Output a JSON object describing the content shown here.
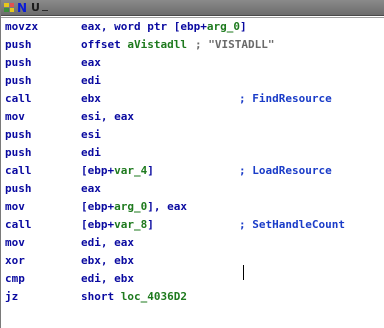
{
  "toolbar": {
    "n_letter": "N",
    "u_letter": "U"
  },
  "lines": [
    {
      "mnemonic": "movzx",
      "operand": "eax, word ptr [ebp+arg_0]"
    },
    {
      "mnemonic": "push",
      "operand": "offset aVistadll",
      "comment": "; \"VISTADLL\""
    },
    {
      "mnemonic": "push",
      "operand": "eax"
    },
    {
      "mnemonic": "push",
      "operand": "edi"
    },
    {
      "mnemonic": "call",
      "operand": "ebx",
      "comment": "; FindResource"
    },
    {
      "mnemonic": "mov",
      "operand": "esi, eax"
    },
    {
      "mnemonic": "push",
      "operand": "esi"
    },
    {
      "mnemonic": "push",
      "operand": "edi"
    },
    {
      "mnemonic": "call",
      "operand": "[ebp+var_4]",
      "comment": "; LoadResource"
    },
    {
      "mnemonic": "push",
      "operand": "eax"
    },
    {
      "mnemonic": "mov",
      "operand": "[ebp+arg_0], eax"
    },
    {
      "mnemonic": "call",
      "operand": "[ebp+var_8]",
      "comment": "; SetHandleCount"
    },
    {
      "mnemonic": "mov",
      "operand": "edi, eax"
    },
    {
      "mnemonic": "xor",
      "operand": "ebx, ebx"
    },
    {
      "mnemonic": "cmp",
      "operand": "edi, ebx"
    },
    {
      "mnemonic": "jz",
      "operand": "short loc_4036D2"
    }
  ],
  "colors": {
    "mnemonic": "#0a0aa0",
    "symbol": "#1e7a1e",
    "comment": "#1a3cc8",
    "string_comment": "#6a6a6a"
  }
}
